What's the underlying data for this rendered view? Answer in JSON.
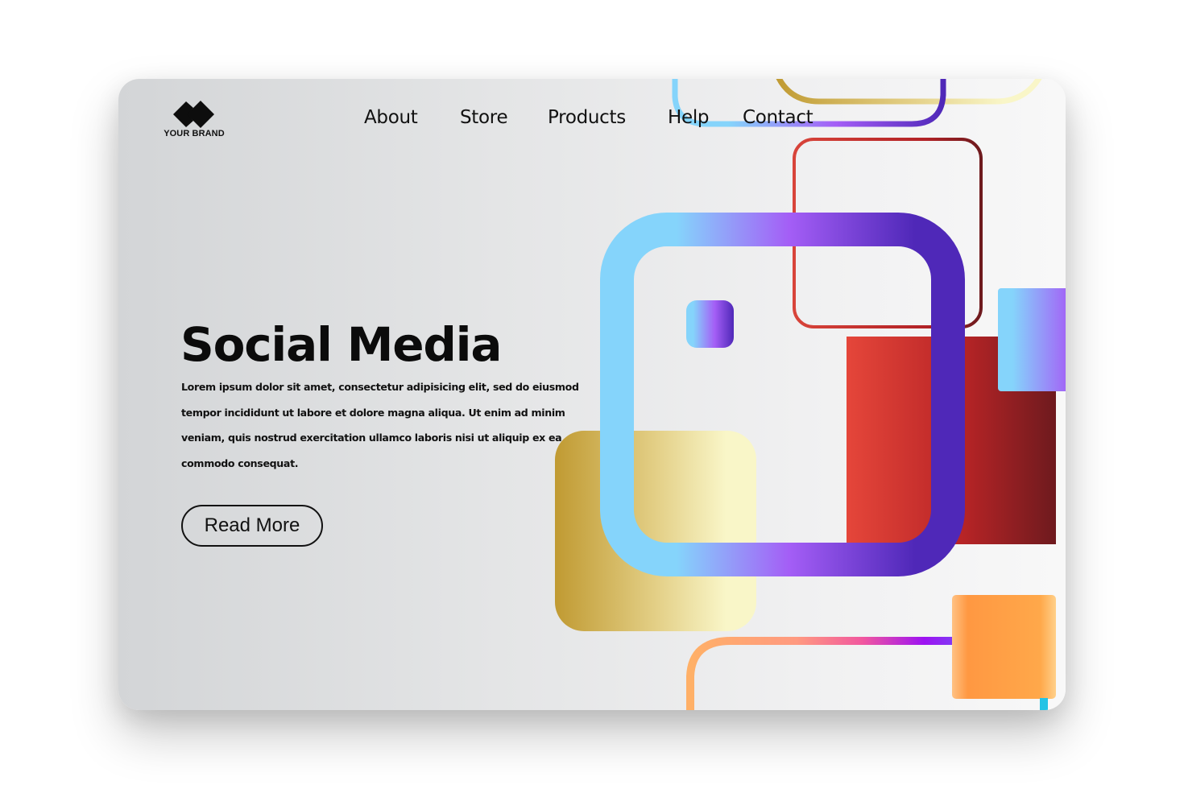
{
  "brand": {
    "logo_icon": "double-diamond-icon",
    "name": "YOUR BRAND"
  },
  "nav": {
    "items": [
      {
        "label": "About"
      },
      {
        "label": "Store"
      },
      {
        "label": "Products"
      },
      {
        "label": "Help"
      },
      {
        "label": "Contact"
      }
    ]
  },
  "hero": {
    "title": "Social Media",
    "body": "Lorem ipsum dolor sit amet, consectetur adipisicing elit, sed do eiusmod tempor incididunt ut labore et dolore magna aliqua. Ut enim ad minim veniam, quis nostrud exercitation ullamco laboris nisi ut aliquip ex ea commodo consequat.",
    "cta_label": "Read More"
  },
  "palette": {
    "sky_blue": "#85d4fb",
    "violet": "#a45ef6",
    "indigo": "#4f28b8",
    "gold_dark": "#c09a32",
    "gold_light": "#f9f6c8",
    "red": "#e5463a",
    "dark_red": "#6e1a1e",
    "orange": "#ff9842",
    "pink": "#f1579f",
    "purple": "#9d12f2",
    "cyan": "#23c3e5"
  }
}
